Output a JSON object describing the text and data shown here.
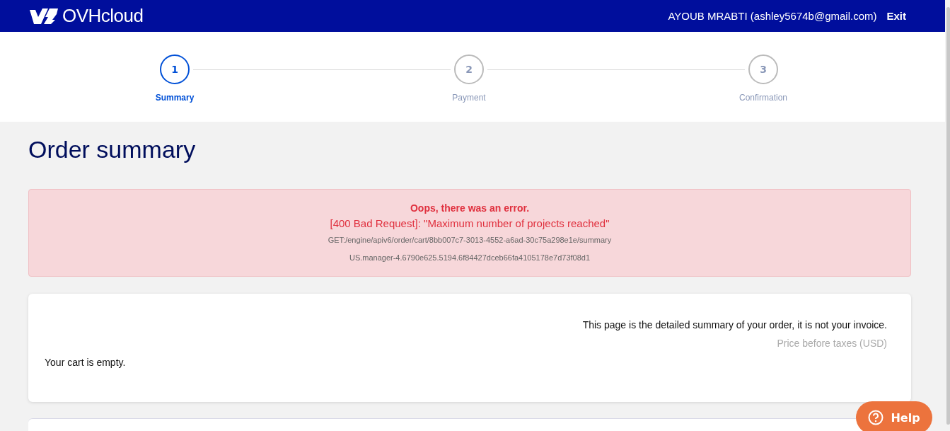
{
  "header": {
    "logo_text": "OVHcloud",
    "user": "AYOUB MRABTI (ashley5674b@gmail.com)",
    "exit": "Exit"
  },
  "steps": [
    {
      "number": "1",
      "label": "Summary",
      "selected": true
    },
    {
      "number": "2",
      "label": "Payment",
      "selected": false
    },
    {
      "number": "3",
      "label": "Confirmation",
      "selected": false
    }
  ],
  "title": "Order summary",
  "error": {
    "heading": "Oops, there was an error.",
    "message": "[400 Bad Request]: \"Maximum number of projects reached\"",
    "request": "GET:/engine/apiv6/order/cart/8bb007c7-3013-4552-a6ad-30c75a298e1e/summary",
    "trace": "US.manager-4.6790e625.5194.6f84427dceb66fa4105178e7d73f08d1"
  },
  "summary_card": {
    "notice": "This page is the detailed summary of your order, it is not your invoice.",
    "price_note": "Price before taxes (USD)",
    "empty": "Your cart is empty."
  },
  "help_button": "Help"
}
